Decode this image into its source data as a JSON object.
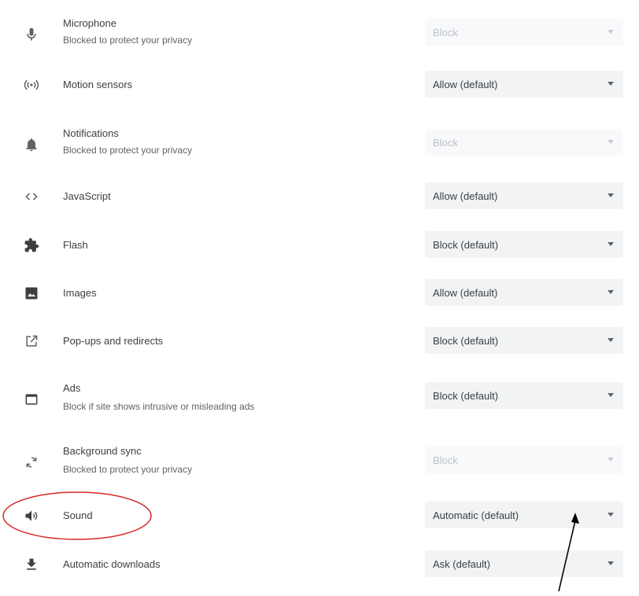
{
  "rows": [
    {
      "title": "Microphone",
      "subtitle": "Blocked to protect your privacy",
      "value": "Block",
      "icon": "microphone-icon"
    },
    {
      "title": "Motion sensors",
      "value": "Allow (default)",
      "icon": "motion-sensors-icon"
    },
    {
      "title": "Notifications",
      "subtitle": "Blocked to protect your privacy",
      "value": "Block",
      "icon": "bell-icon"
    },
    {
      "title": "JavaScript",
      "value": "Allow (default)",
      "icon": "code-icon"
    },
    {
      "title": "Flash",
      "value": "Block (default)",
      "icon": "puzzle-icon"
    },
    {
      "title": "Images",
      "value": "Allow (default)",
      "icon": "image-icon"
    },
    {
      "title": "Pop-ups and redirects",
      "value": "Block (default)",
      "icon": "open-in-new-icon"
    },
    {
      "title": "Ads",
      "subtitle": "Block if site shows intrusive or misleading ads",
      "value": "Block (default)",
      "icon": "ads-window-icon"
    },
    {
      "title": "Background sync",
      "subtitle": "Blocked to protect your privacy",
      "value": "Block",
      "icon": "sync-icon"
    },
    {
      "title": "Sound",
      "value": "Automatic (default)",
      "icon": "volume-icon"
    },
    {
      "title": "Automatic downloads",
      "value": "Ask (default)",
      "icon": "download-icon"
    }
  ],
  "colors": {
    "annotation": "#d62828",
    "arrow": "#000000"
  }
}
